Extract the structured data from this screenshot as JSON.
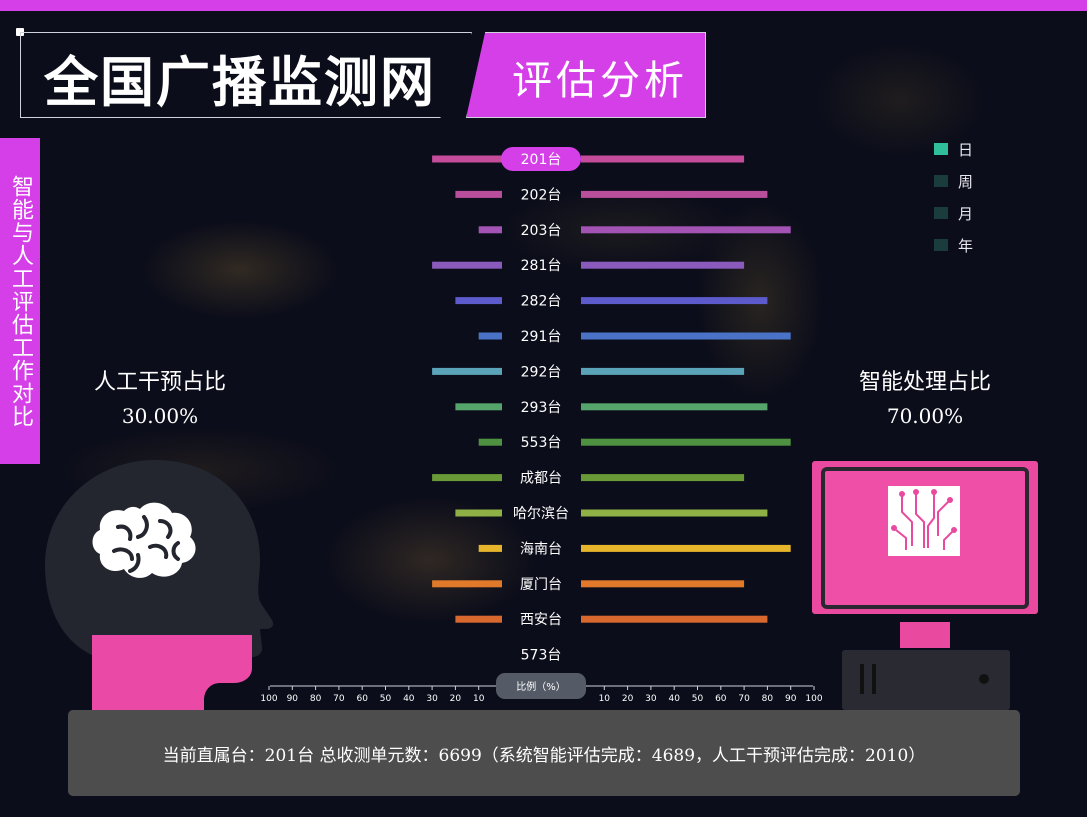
{
  "header": {
    "title": "全国广播监测网",
    "subtitle": "评估分析"
  },
  "sidebar": {
    "tab_label": "智能与人工评估工作对比"
  },
  "left_panel": {
    "label": "人工干预占比",
    "value": "30.00%"
  },
  "right_panel": {
    "label": "智能处理占比",
    "value": "70.00%"
  },
  "legend": {
    "items": [
      {
        "label": "日",
        "color": "#2fbf9b"
      },
      {
        "label": "周",
        "color": "#1a3c3c"
      },
      {
        "label": "月",
        "color": "#1a3c3c"
      },
      {
        "label": "年",
        "color": "#1a3c3c"
      }
    ]
  },
  "chart_data": {
    "type": "bar",
    "orientation": "horizontal-butterfly",
    "axis_label": "比例（%）",
    "axis_ticks": [
      100,
      90,
      80,
      70,
      60,
      50,
      40,
      30,
      20,
      10
    ],
    "xlim": [
      0,
      100
    ],
    "selected_category": "201台",
    "categories": [
      "201台",
      "202台",
      "203台",
      "281台",
      "282台",
      "291台",
      "292台",
      "293台",
      "553台",
      "成都台",
      "哈尔滨台",
      "海南台",
      "厦门台",
      "西安台",
      "573台"
    ],
    "series": [
      {
        "side": "left",
        "values": [
          30,
          20,
          10,
          30,
          20,
          10,
          30,
          20,
          10,
          30,
          20,
          10,
          30,
          20,
          0
        ]
      },
      {
        "side": "right",
        "values": [
          70,
          80,
          90,
          70,
          80,
          90,
          70,
          80,
          90,
          70,
          80,
          90,
          70,
          80,
          0
        ]
      }
    ],
    "colors": [
      "#c44c9a",
      "#b84e9c",
      "#a353b3",
      "#8a5bbd",
      "#5d5bcb",
      "#4a73c8",
      "#5aa3b8",
      "#55a46b",
      "#4e9140",
      "#6a9a37",
      "#8fb044",
      "#e6b52b",
      "#e07a2a",
      "#d9682f",
      "#888888"
    ]
  },
  "footer": {
    "text": "当前直属台：201台   总收测单元数：6699（系统智能评估完成：4689，人工干预评估完成：2010）"
  }
}
